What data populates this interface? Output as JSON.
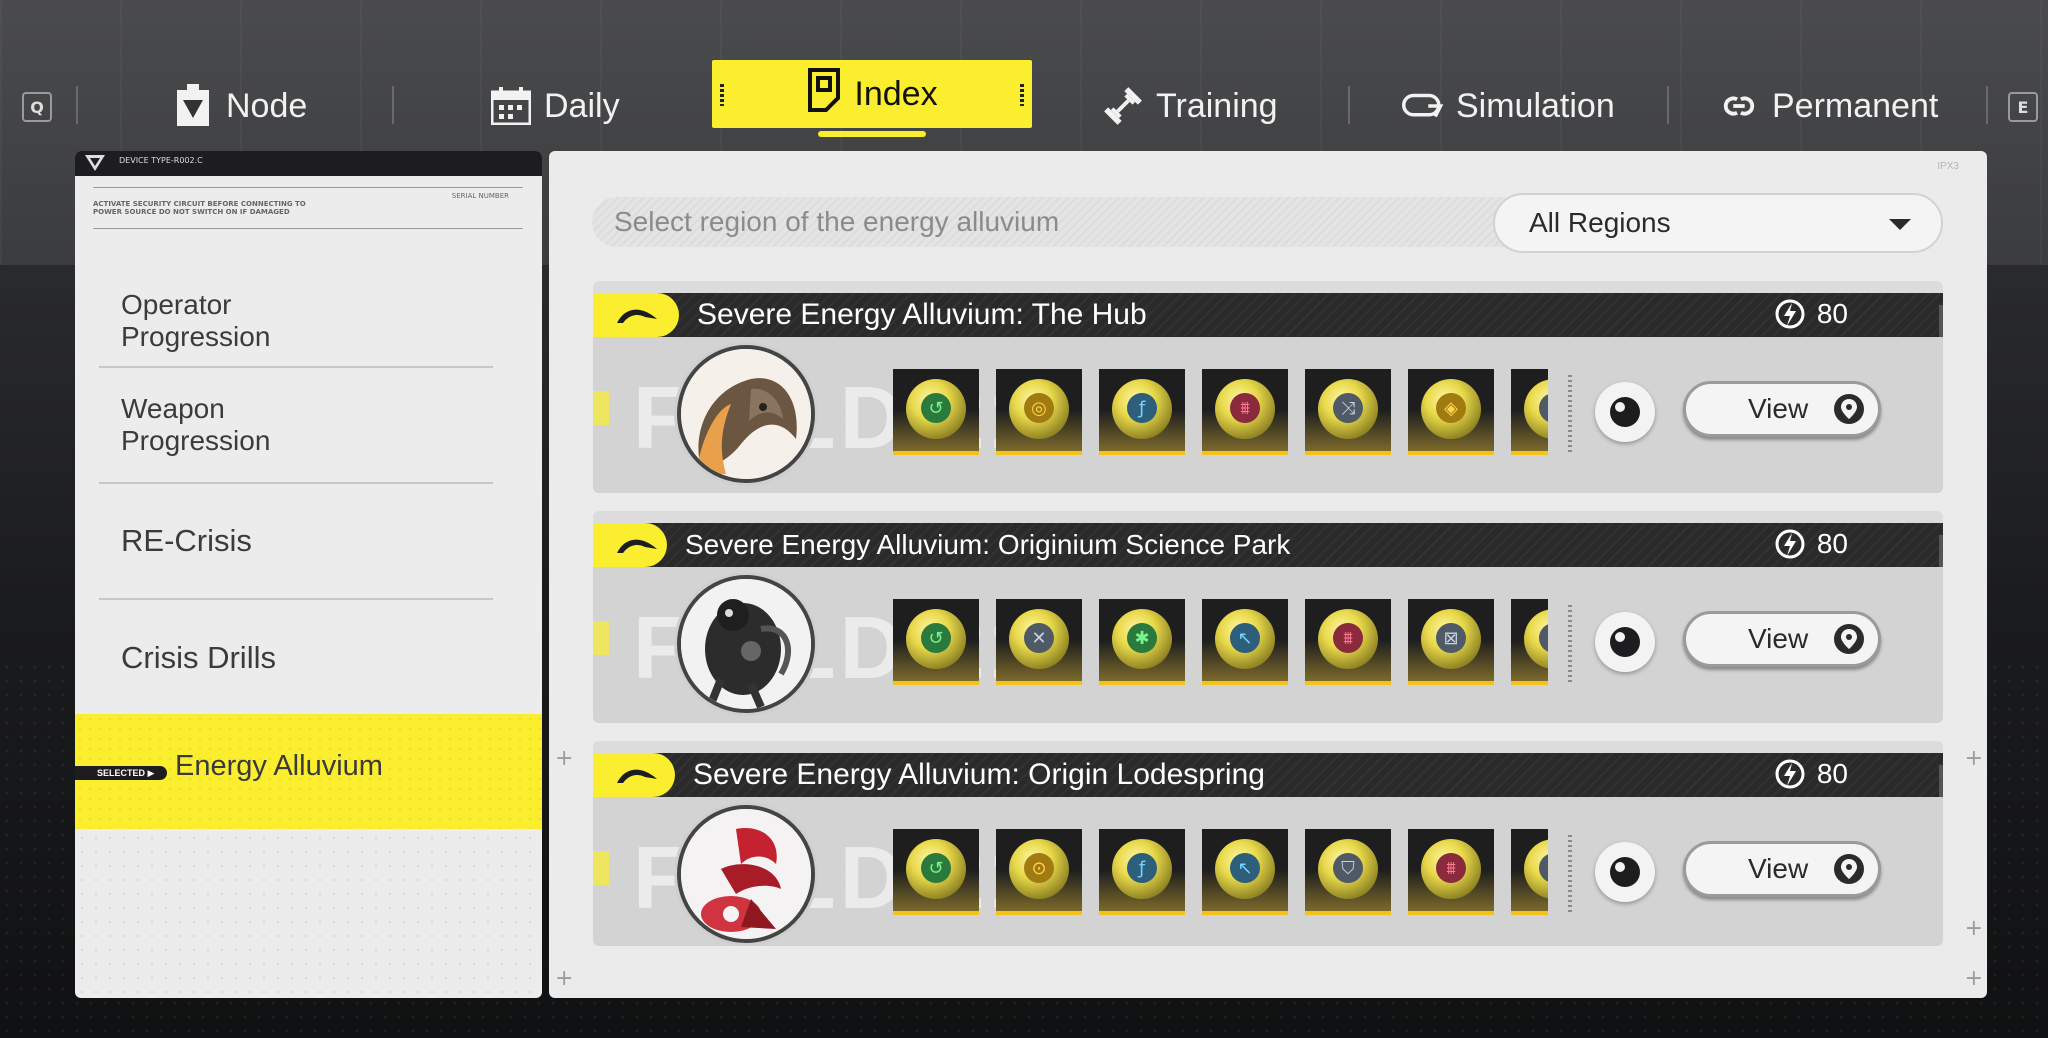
{
  "nav": {
    "left_key": "Q",
    "right_key": "E",
    "tabs": [
      {
        "label": "Node",
        "icon": "node-icon"
      },
      {
        "label": "Daily",
        "icon": "calendar-icon"
      },
      {
        "label": "Index",
        "icon": "index-icon",
        "active": true
      },
      {
        "label": "Training",
        "icon": "training-icon"
      },
      {
        "label": "Simulation",
        "icon": "simulation-icon"
      },
      {
        "label": "Permanent",
        "icon": "permanent-icon"
      }
    ]
  },
  "sidebar": {
    "header_text": "DEVICE TYPE-R002.C",
    "notice": "ACTIVATE SECURITY CIRCUIT BEFORE CONNECTING TO POWER SOURCE  DO NOT SWITCH ON IF DAMAGED",
    "serial_label": "SERIAL NUMBER",
    "items": [
      {
        "label": "Operator Progression"
      },
      {
        "label": "Weapon Progression"
      },
      {
        "label": "RE-Crisis"
      },
      {
        "label": "Crisis Drills"
      }
    ],
    "selected_badge": "SELECTED ▶",
    "selected_label": "Energy Alluvium"
  },
  "main": {
    "region_prompt": "Select region of the energy alluvium",
    "region_selected": "All Regions",
    "corner_tag": "IPX3",
    "cards": [
      {
        "title": "Severe Energy Alluvium: The Hub",
        "energy": "80",
        "view_label": "View",
        "watermark": "FIELD 21"
      },
      {
        "title": "Severe Energy Alluvium: Originium Science Park",
        "energy": "80",
        "view_label": "View",
        "watermark": "FIELD 21"
      },
      {
        "title": "Severe Energy Alluvium: Origin Lodespring",
        "energy": "80",
        "view_label": "View",
        "watermark": "FIELD 21"
      }
    ]
  },
  "colors": {
    "accent": "#fbee2f",
    "panel": "#ebebeb",
    "dark": "#2a2a2b"
  }
}
